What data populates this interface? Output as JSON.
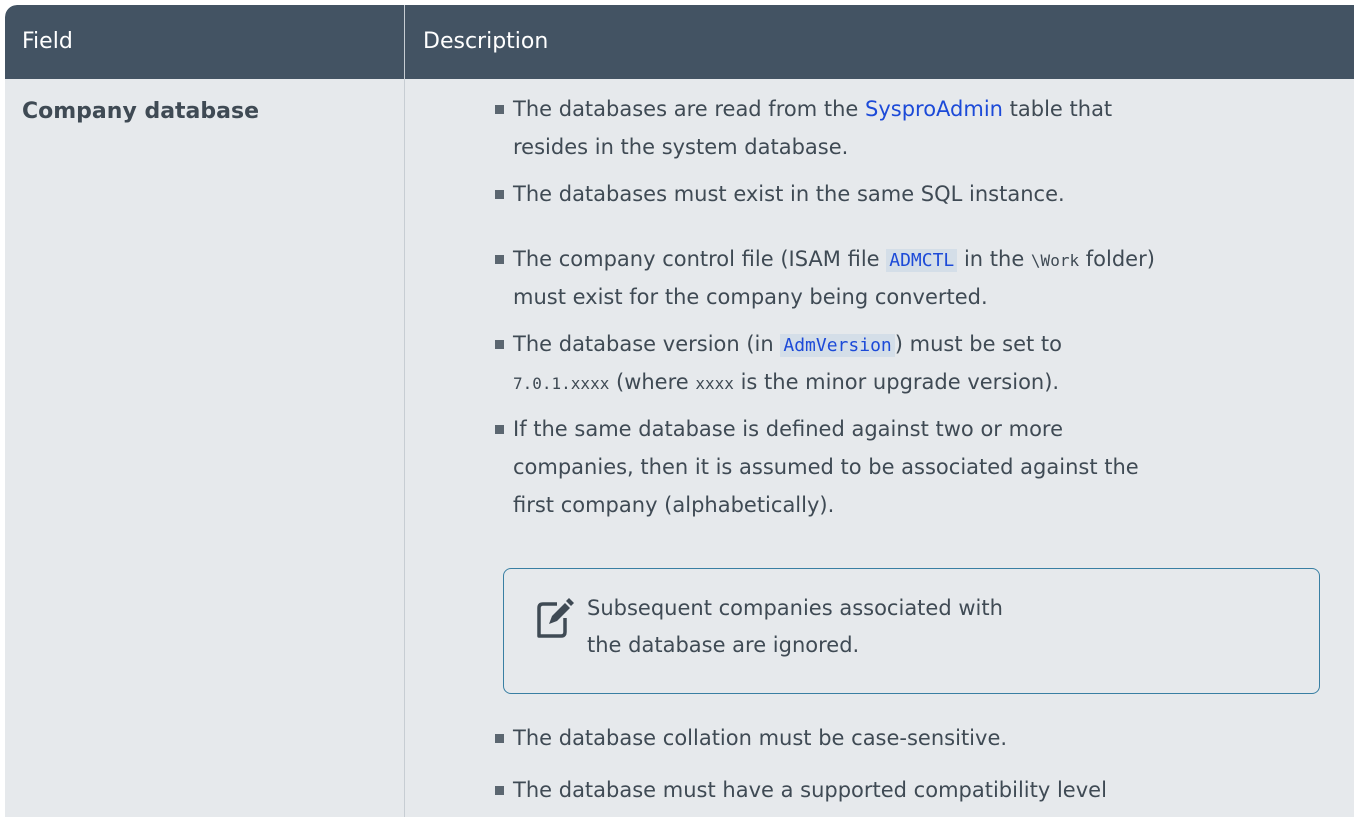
{
  "table": {
    "header": {
      "field_label": "Field",
      "description_label": "Description"
    },
    "row": {
      "field_name": "Company database",
      "bullets": {
        "b1": {
          "line1_pre": "The databases are read from the ",
          "line1_link": "SysproAdmin",
          "line1_post": " table that",
          "line2": "resides in the system database."
        },
        "b2": {
          "line1": "The databases must exist in the same SQL instance."
        },
        "b3": {
          "line1_pre": "The company control file (ISAM file ",
          "line1_code": "ADMCTL",
          "line1_mid": " in the ",
          "line1_path": "\\Work",
          "line1_post": " folder)",
          "line2": "must exist for the company being converted."
        },
        "b4": {
          "line1_pre": "The database version (in ",
          "line1_code": "AdmVersion",
          "line1_post": ") must be set to",
          "line2_code": "7.0.1.xxxx",
          "line2_mid": " (where ",
          "line2_code2": "xxxx",
          "line2_post": " is the minor upgrade version)."
        },
        "b5": {
          "line1": "If the same database is defined against two or more",
          "line2": "companies, then it is assumed to be associated against the",
          "line3": "first company (alphabetically)."
        },
        "b6": {
          "line1": "The database collation must be case-sensitive."
        },
        "b7": {
          "line1": "The database must have a supported compatibility level"
        }
      },
      "note": {
        "icon": "note-edit-icon",
        "line1": "Subsequent companies associated with",
        "line2": "the database are ignored."
      }
    }
  },
  "colors": {
    "header_bg": "#435363",
    "body_bg": "#e6e9ec",
    "link": "#1c4ad8",
    "note_border": "#397fa3"
  }
}
